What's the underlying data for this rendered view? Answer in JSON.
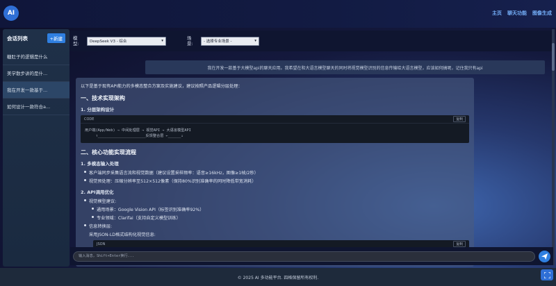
{
  "header": {
    "logo": "AI",
    "nav": [
      "主页",
      "聊天功能",
      "图像生成"
    ]
  },
  "sidebar": {
    "title": "会话列表",
    "new_button": "+新建",
    "items": [
      "糖肚子的逻辑是什么",
      "美学散步讲的是什...",
      "我在开发一款基于...",
      "如何设计一款符合a..."
    ]
  },
  "selectors": {
    "model_label": "模型:",
    "model_value": "DeepSeek V3 - 综合",
    "scene_label": "场景:",
    "scene_value": "- 选择专业场景 -"
  },
  "user_message": "我在开发一款基于大模型api的聊天应用。我希望在和大语言模型聊天的同时将视觉模型识别的信息传输给大语言模型，应该如何搞呢，记住我只有api",
  "response": {
    "intro": "以下是基于现有API能力的多模态整合方案及实施建议，建议按照产品逻辑分层处理：",
    "h1": "一、技术实现架构",
    "h1_sub": "1. 分层架构设计",
    "code1_lang": "CODE",
    "copy_label": "复制",
    "code1_line1": "用户端(App/Web) → 中间处理层 → 视觉API → 大语言模型API",
    "code1_line2": "     ↑______________________反馈整合层 ←______↓",
    "h2": "二、核心功能实现流程",
    "h2_sub1": "1. 多模态输入处理",
    "bullets1": [
      "客户端同步采集语言流和视觉数据（建议设置采样频率：语音≥16kHz，图像≥1帧/2秒）",
      "视觉预处理：压缩分辨率至512×512像素（保持80%识别准确率的同时降低带宽消耗）"
    ],
    "h2_sub2": "2. API调用优化",
    "bullet2a": "视觉模型建议:",
    "bullets2": [
      "通用场景：Google Vision API（标签识别准确率92%）",
      "专业领域：Clarifai（支持自定义模型训练）"
    ],
    "bullet2b": "信息转换层:",
    "bullet2b_text": "采用JSON-LD格式结构化视觉信息:",
    "code2_lang": "JSON"
  },
  "input": {
    "placeholder": "输入消息，Shift+Enter换行..."
  },
  "footer": {
    "text": "© 2025 AI 多功能平台. 四格保留所有权利."
  }
}
